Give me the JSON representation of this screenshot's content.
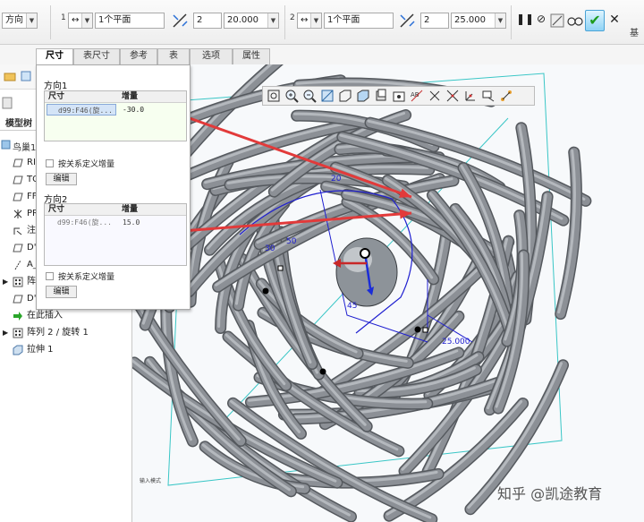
{
  "toolbar": {
    "dir_combo": "方向",
    "dir1": {
      "index": "1",
      "ref_value": "1个平面",
      "count": "2",
      "increment": "20.000"
    },
    "dir2": {
      "index": "2",
      "ref_value": "1个平面",
      "count": "2",
      "increment": "25.000"
    },
    "overflow_label": "基"
  },
  "tabs": [
    "尺寸",
    "表尺寸",
    "参考",
    "表",
    "选项",
    "属性"
  ],
  "tree": {
    "title": "模型树",
    "root": "鸟巢1",
    "items": [
      "RI",
      "TO",
      "FF",
      "PR",
      "注",
      "D'",
      "A_",
      "阵",
      "D'",
      "在此插入",
      "阵列 2 / 旋转 1",
      "拉伸 1"
    ]
  },
  "popup": {
    "section1_title": "方向1",
    "section2_title": "方向2",
    "col_dim": "尺寸",
    "col_inc": "增量",
    "row1": {
      "dim": "d99:F46(旋...",
      "inc": "-30.0"
    },
    "row2": {
      "dim": "d99:F46(旋...",
      "inc": "15.0"
    },
    "relation_label": "按关系定义增量",
    "edit_label": "编辑"
  },
  "viewport": {
    "dim_labels": [
      "30",
      "50",
      "25.000",
      "45",
      "20"
    ],
    "watermark": "知乎 @凯途教育",
    "corner_note": "输入模式"
  },
  "colors": {
    "accent": "#4aa3d6",
    "check": "#1d9b1d",
    "arrow": "#e23a3a",
    "dim": "#2020d0",
    "rod": "#8c9096"
  }
}
